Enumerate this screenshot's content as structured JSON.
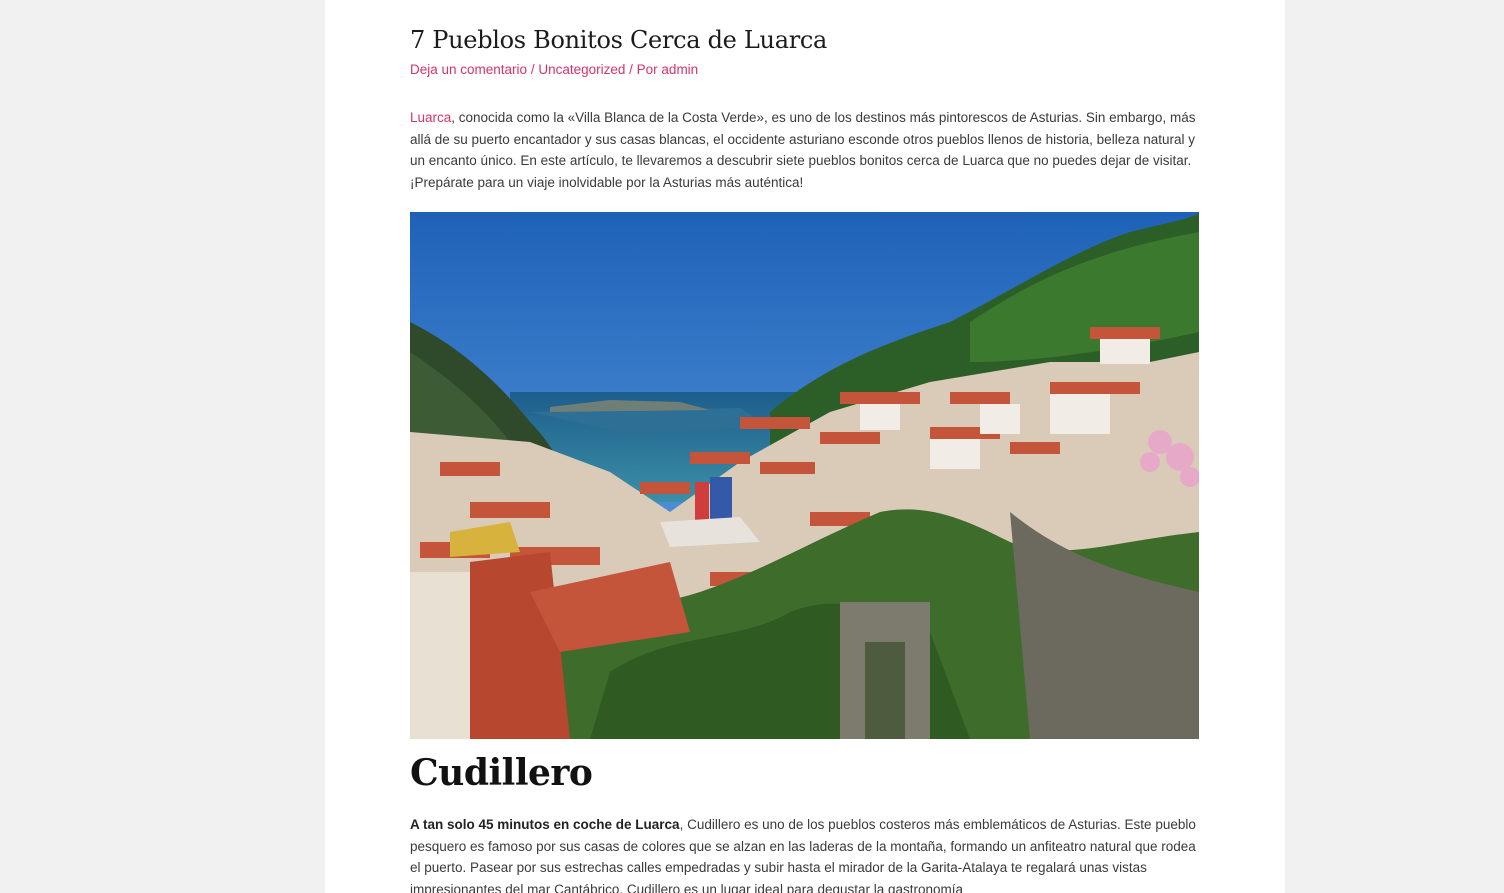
{
  "post": {
    "title": "7 Pueblos Bonitos Cerca de Luarca",
    "meta": {
      "comment_link": "Deja un comentario",
      "separator": " / ",
      "category": "Uncategorized",
      "by_prefix": " / Por ",
      "author": "admin"
    },
    "intro": {
      "link_text": "Luarca",
      "text": ", conocida como la «Villa Blanca de la Costa Verde», es uno de los destinos más pintorescos de Asturias. Sin embargo, más allá de su puerto encantador y sus casas blancas, el occidente asturiano esconde otros pueblos llenos de historia, belleza natural y un encanto único. En este artículo, te llevaremos a descubrir siete pueblos bonitos cerca de Luarca que no puedes dejar de visitar. ¡Prepárate para un viaje inolvidable por la Asturias más auténtica!"
    },
    "section": {
      "heading": "Cudillero",
      "bold_lead": "A tan solo 45 minutos en coche de Luarca",
      "text": ", Cudillero es uno de los pueblos costeros más emblemáticos de Asturias. Este pueblo pesquero es famoso por sus casas de colores que se alzan en las laderas de la montaña, formando un anfiteatro natural que rodea el puerto. Pasear por sus estrechas calles empedradas y subir hasta el mirador de la Garita-Atalaya te regalará unas vistas impresionantes del mar Cantábrico. Cudillero es un lugar ideal para degustar la gastronomía"
    }
  },
  "colors": {
    "accent": "#d6336c",
    "page_bg": "#f1f1f1",
    "content_bg": "#ffffff"
  }
}
